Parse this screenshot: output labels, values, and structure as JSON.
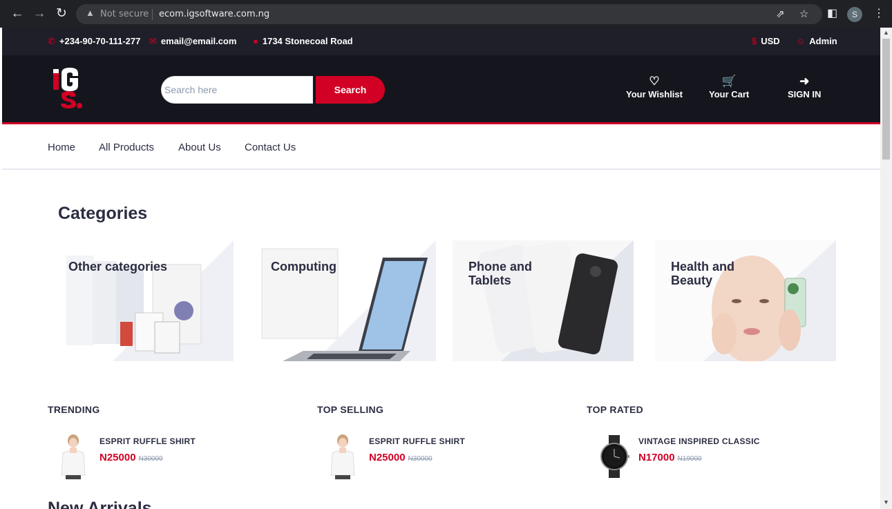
{
  "browser": {
    "security_label": "Not secure",
    "url": "ecom.igsoftware.com.ng",
    "profile_initial": "S"
  },
  "topbar": {
    "phone": "+234-90-70-111-277",
    "email": "email@email.com",
    "address": "1734 Stonecoal Road",
    "currency": "USD",
    "account": "Admin"
  },
  "header": {
    "search_placeholder": "Search here",
    "search_button": "Search",
    "wishlist": "Your Wishlist",
    "cart": "Your Cart",
    "signin": "SIGN IN"
  },
  "nav": {
    "items": [
      "Home",
      "All Products",
      "About Us",
      "Contact Us"
    ]
  },
  "categories": {
    "title": "Categories",
    "items": [
      {
        "label": "Other categories",
        "icon": "grocery-boxes"
      },
      {
        "label": "Computing",
        "icon": "laptop"
      },
      {
        "label": "Phone and Tablets",
        "icon": "smartphone"
      },
      {
        "label": "Health and Beauty",
        "icon": "beauty-face"
      }
    ]
  },
  "columns": [
    {
      "title": "TRENDING",
      "product": {
        "name": "ESPRIT RUFFLE SHIRT",
        "price": "N25000",
        "old_price": "N30000",
        "image": "shirt-model"
      }
    },
    {
      "title": "TOP SELLING",
      "product": {
        "name": "ESPRIT RUFFLE SHIRT",
        "price": "N25000",
        "old_price": "N30000",
        "image": "shirt-model"
      }
    },
    {
      "title": "TOP RATED",
      "product": {
        "name": "VINTAGE INSPIRED CLASSIC",
        "price": "N17000",
        "old_price": "N19000",
        "image": "watch"
      }
    }
  ],
  "new_arrivals": "New Arrivals",
  "colors": {
    "accent": "#d10024",
    "dark": "#15161d",
    "topbar": "#1e1f29",
    "text": "#2b2d42"
  }
}
